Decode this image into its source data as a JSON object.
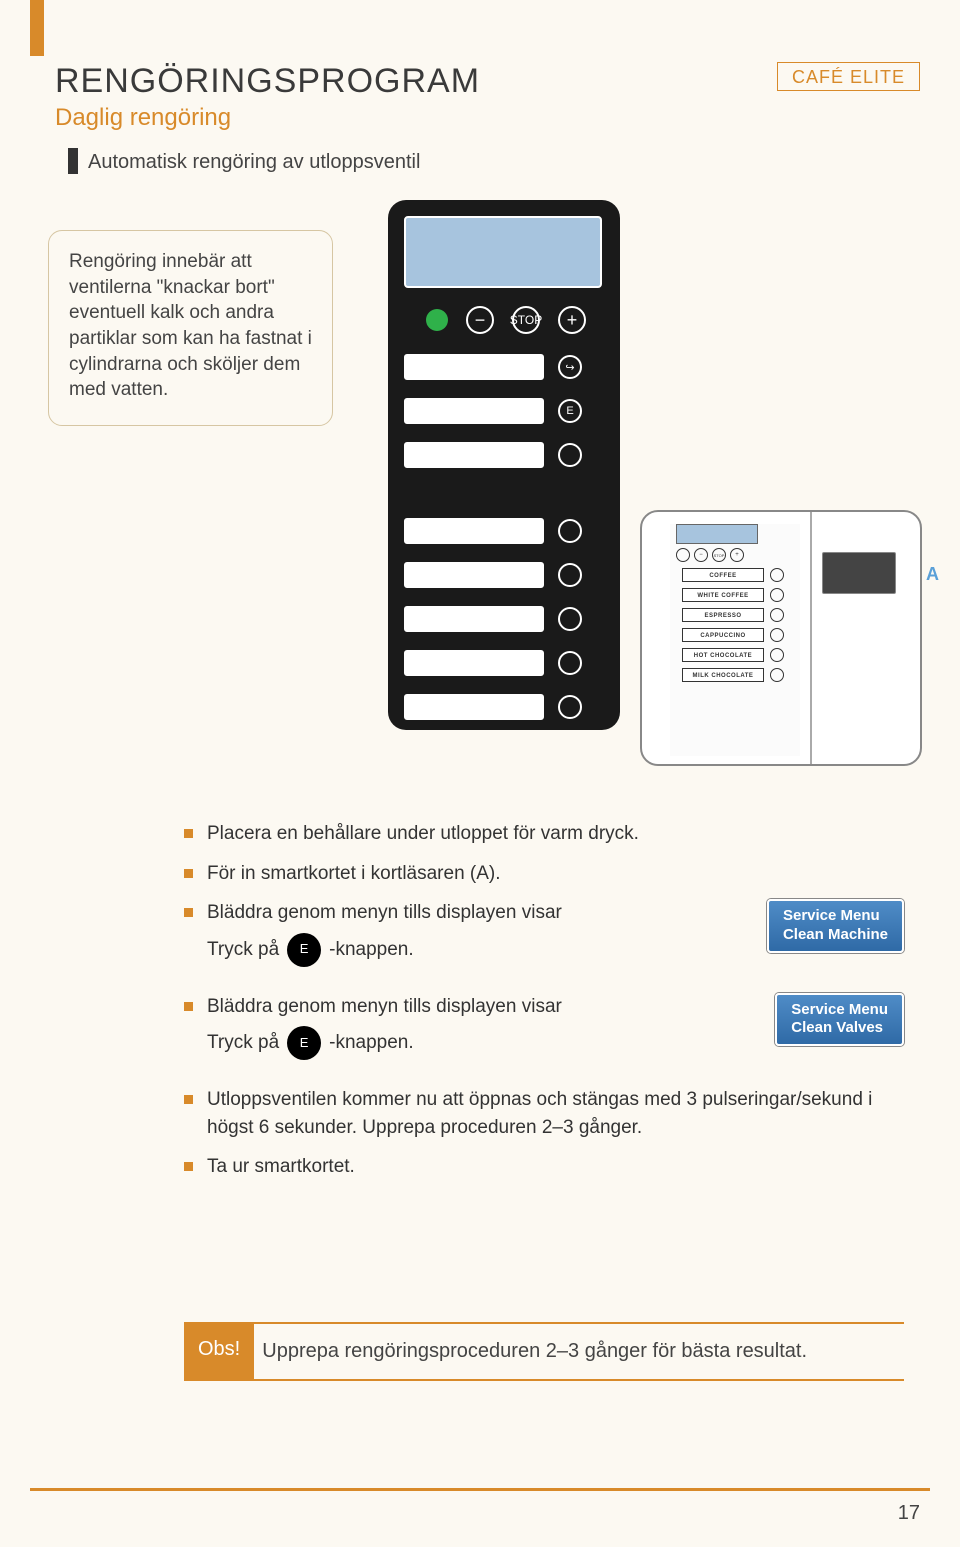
{
  "header": {
    "title": "RENGÖRINGSPROGRAM",
    "subtitle": "Daglig rengöring",
    "brand": "CAFÉ ELITE",
    "section": "Automatisk rengöring av utloppsventil"
  },
  "note": "Rengöring innebär att ventilerna \"knackar bort\" eventuell kalk och andra partiklar som kan ha fastnat i cylindrarna och sköljer dem med vatten.",
  "diagram": {
    "stop": "STOP",
    "minus": "−",
    "plus": "+",
    "e": "E",
    "arrow": "↪"
  },
  "machine": {
    "labels": [
      "COFFEE",
      "WHITE COFFEE",
      "ESPRESSO",
      "CAPPUCCINO",
      "HOT CHOCOLATE",
      "MILK CHOCOLATE"
    ],
    "callout": "A",
    "stop": "STOP"
  },
  "instructions": {
    "items": [
      "Placera en behållare under utloppet för varm dryck.",
      "För in smartkortet i kortläsaren (A).",
      "Bläddra genom menyn tills displayen visar",
      "Bläddra genom menyn tills displayen visar",
      "Utloppsventilen kommer nu att öppnas och stängas med 3 pulseringar/sekund i högst 6 sekunder. Upprepa proceduren 2–3 gånger.",
      "Ta ur smartkortet."
    ],
    "press_prefix": "Tryck på",
    "press_suffix": "-knappen.",
    "e": "E"
  },
  "chips": {
    "chip1_line1": "Service Menu",
    "chip1_line2": "Clean Machine",
    "chip2_line1": "Service Menu",
    "chip2_line2": "Clean Valves"
  },
  "obs": {
    "label": "Obs!",
    "text": "Upprepa rengöringsproceduren 2–3 gånger för bästa resultat."
  },
  "page_number": "17"
}
